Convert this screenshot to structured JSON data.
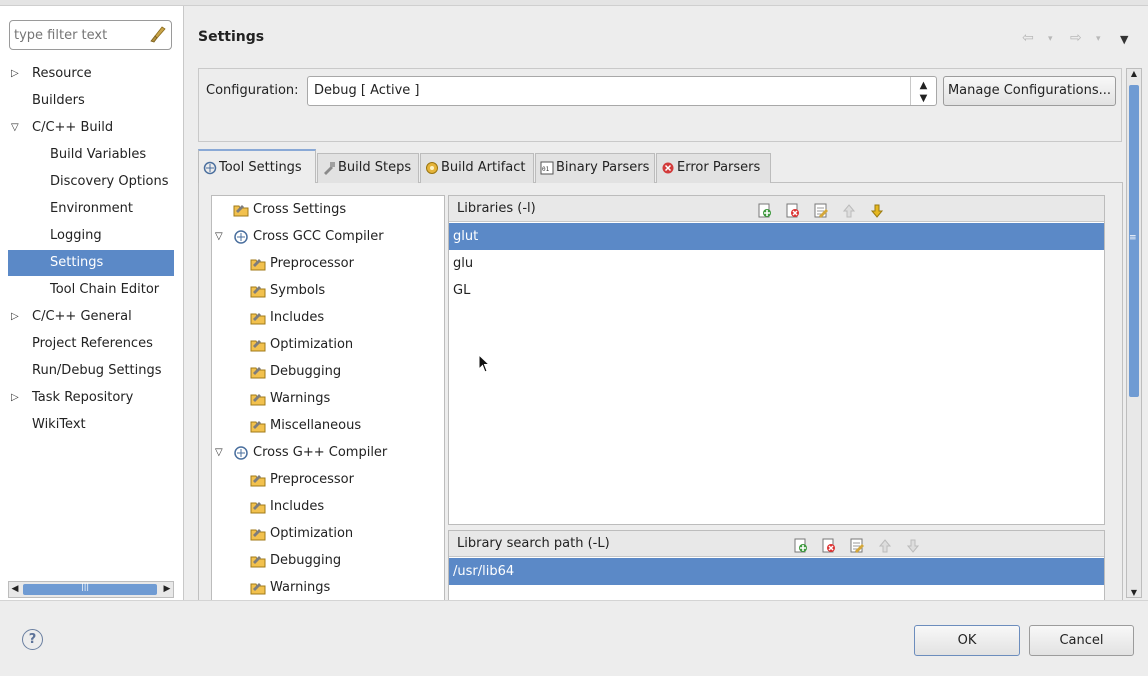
{
  "filter": {
    "placeholder": "type filter text"
  },
  "nav": {
    "items": [
      {
        "label": "Resource",
        "expander": "right"
      },
      {
        "label": "Builders"
      },
      {
        "label": "C/C++ Build",
        "expander": "down"
      },
      {
        "label": "Build Variables"
      },
      {
        "label": "Discovery Options"
      },
      {
        "label": "Environment"
      },
      {
        "label": "Logging"
      },
      {
        "label": "Settings",
        "selected": true
      },
      {
        "label": "Tool Chain Editor"
      },
      {
        "label": "C/C++ General",
        "expander": "right"
      },
      {
        "label": "Project References"
      },
      {
        "label": "Run/Debug Settings"
      },
      {
        "label": "Task Repository",
        "expander": "right"
      },
      {
        "label": "WikiText"
      }
    ],
    "hscroll_grip": "|||"
  },
  "page": {
    "title": "Settings"
  },
  "config": {
    "label": "Configuration:",
    "value": "Debug  [ Active ]",
    "manage_label": "Manage Configurations..."
  },
  "tabs": [
    {
      "label": "Tool Settings",
      "active": true,
      "icon": "tool-settings-icon"
    },
    {
      "label": "Build Steps",
      "icon": "build-steps-icon"
    },
    {
      "label": "Build Artifact",
      "icon": "build-artifact-icon"
    },
    {
      "label": "Binary Parsers",
      "icon": "binary-parsers-icon"
    },
    {
      "label": "Error Parsers",
      "icon": "error-parsers-icon"
    }
  ],
  "tool_tree": [
    {
      "label": "Cross Settings"
    },
    {
      "label": "Cross GCC Compiler",
      "expander": "down"
    },
    {
      "label": "Preprocessor"
    },
    {
      "label": "Symbols"
    },
    {
      "label": "Includes"
    },
    {
      "label": "Optimization"
    },
    {
      "label": "Debugging"
    },
    {
      "label": "Warnings"
    },
    {
      "label": "Miscellaneous"
    },
    {
      "label": "Cross G++ Compiler",
      "expander": "down"
    },
    {
      "label": "Preprocessor"
    },
    {
      "label": "Includes"
    },
    {
      "label": "Optimization"
    },
    {
      "label": "Debugging"
    },
    {
      "label": "Warnings"
    }
  ],
  "libraries": {
    "header": "Libraries (-l)",
    "items": [
      "glut",
      "glu",
      "GL"
    ],
    "selected": "glut"
  },
  "library_paths": {
    "header": "Library search path (-L)",
    "items": [
      "/usr/lib64"
    ],
    "selected": "/usr/lib64"
  },
  "buttons": {
    "ok": "OK",
    "cancel": "Cancel",
    "help": "?"
  },
  "colors": {
    "selection": "#5b89c7",
    "scroll_thumb": "#6f9bd3"
  }
}
